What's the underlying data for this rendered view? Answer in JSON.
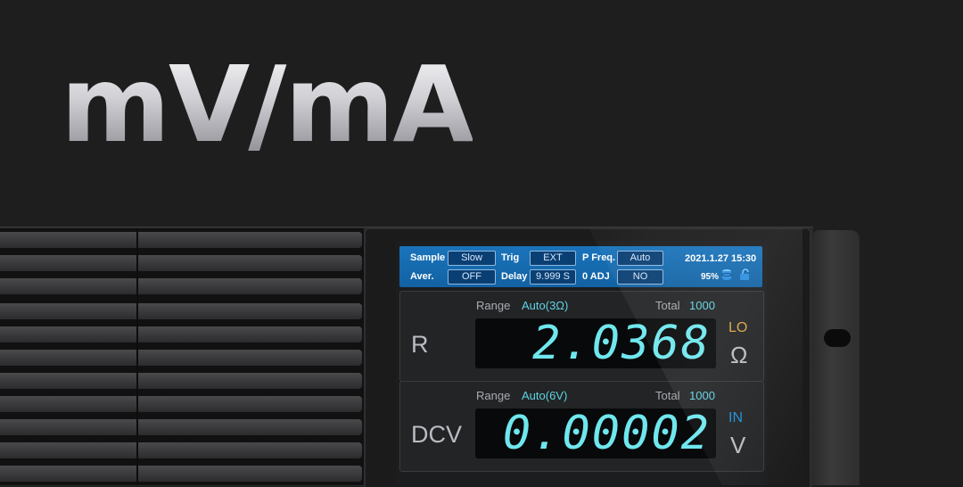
{
  "hero": {
    "title": "mV/mA"
  },
  "status_bar": {
    "sample_label": "Sample",
    "sample_value": "Slow",
    "trig_label": "Trig",
    "trig_value": "EXT",
    "pfreq_label": "P Freq.",
    "pfreq_value": "Auto",
    "datetime": "2021.1.27 15:30",
    "aver_label": "Aver.",
    "aver_value": "OFF",
    "delay_label": "Delay",
    "delay_value": "9.999 S",
    "adj_label": "0 ADJ",
    "adj_value": "NO",
    "battery": "95%",
    "icons": [
      "database-icon",
      "lock-open-icon"
    ]
  },
  "panels": [
    {
      "range_label": "Range",
      "range_value": "Auto(3Ω)",
      "total_label": "Total",
      "total_value": "1000",
      "function": "R",
      "reading": "2.0368",
      "mode": "LO",
      "mode_color": "#d9a441",
      "unit": "Ω"
    },
    {
      "range_label": "Range",
      "range_value": "Auto(6V)",
      "total_label": "Total",
      "total_value": "1000",
      "function": "DCV",
      "reading": "0.00002",
      "mode": "IN",
      "mode_color": "#1f8fd8",
      "unit": "V"
    }
  ],
  "colors": {
    "accent": "#1a74bb",
    "readout": "#6fe7ee",
    "background": "#1e1e1f"
  }
}
